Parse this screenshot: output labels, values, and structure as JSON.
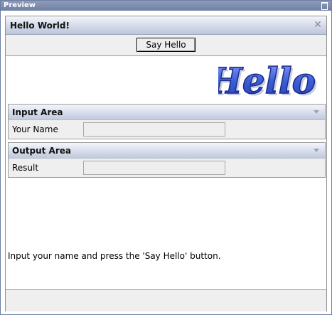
{
  "window": {
    "title": "Preview"
  },
  "panel": {
    "title": "Hello World!",
    "say_hello_label": "Say Hello",
    "logo_text": "Hello",
    "hint": "Input your name and press the 'Say Hello' button."
  },
  "input_area": {
    "title": "Input Area",
    "field_label": "Your Name",
    "field_value": ""
  },
  "output_area": {
    "title": "Output Area",
    "field_label": "Result",
    "field_value": ""
  },
  "colors": {
    "titlebar": "#6f80a4",
    "logo_fill": "#3c5fd6",
    "logo_outline": "#1b2a8a"
  },
  "icons": {
    "close": "close-icon",
    "restore": "restore-icon",
    "collapse": "chevron-down-icon"
  }
}
